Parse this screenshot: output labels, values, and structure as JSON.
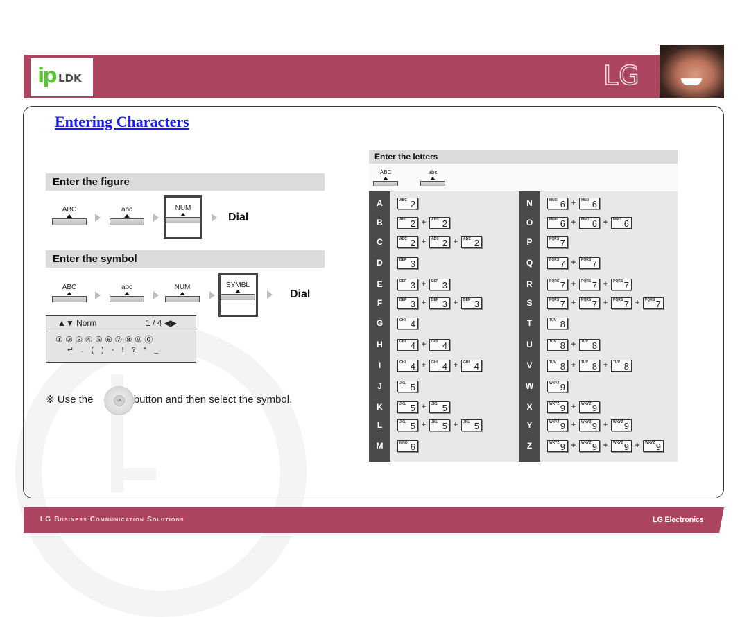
{
  "header": {
    "logo_ip": "ip",
    "logo_ldk": "LDK",
    "brand": "LG"
  },
  "title": "Entering Characters",
  "figure_section": {
    "heading": "Enter the figure",
    "modes": [
      "ABC",
      "abc",
      "NUM"
    ],
    "highlighted": "NUM",
    "result": "Dial"
  },
  "symbol_section": {
    "heading": "Enter the symbol",
    "modes": [
      "ABC",
      "abc",
      "NUM",
      "SYMBL"
    ],
    "highlighted": "SYMBL",
    "result": "Dial",
    "panel": {
      "mode": "▲▼ Norm",
      "page": "1 / 4  ◀▶",
      "row1": "①②③④⑤⑥⑦⑧⑨⓪",
      "row2": "↵ . ( ) - ! ? * _"
    },
    "hint_prefix": "※ Use the",
    "hint_suffix": "button and then select the symbol.",
    "nav_button_label": "OK"
  },
  "letters_section": {
    "heading": "Enter the letters",
    "modes": [
      "ABC",
      "abc"
    ],
    "rows_left": [
      {
        "letter": "A",
        "key_label": "ABC",
        "key": "2",
        "presses": 1
      },
      {
        "letter": "B",
        "key_label": "ABC",
        "key": "2",
        "presses": 2
      },
      {
        "letter": "C",
        "key_label": "ABC",
        "key": "2",
        "presses": 3
      },
      {
        "letter": "D",
        "key_label": "DEF",
        "key": "3",
        "presses": 1
      },
      {
        "letter": "E",
        "key_label": "DEF",
        "key": "3",
        "presses": 2
      },
      {
        "letter": "F",
        "key_label": "DEF",
        "key": "3",
        "presses": 3
      },
      {
        "letter": "G",
        "key_label": "GHI",
        "key": "4",
        "presses": 1
      },
      {
        "letter": "H",
        "key_label": "GHI",
        "key": "4",
        "presses": 2
      },
      {
        "letter": "I",
        "key_label": "GHI",
        "key": "4",
        "presses": 3
      },
      {
        "letter": "J",
        "key_label": "JKL",
        "key": "5",
        "presses": 1
      },
      {
        "letter": "K",
        "key_label": "JKL",
        "key": "5",
        "presses": 2
      },
      {
        "letter": "L",
        "key_label": "JKL",
        "key": "5",
        "presses": 3
      },
      {
        "letter": "M",
        "key_label": "MNO",
        "key": "6",
        "presses": 1
      }
    ],
    "rows_right": [
      {
        "letter": "N",
        "key_label": "MNO",
        "key": "6",
        "presses": 2
      },
      {
        "letter": "O",
        "key_label": "MNO",
        "key": "6",
        "presses": 3
      },
      {
        "letter": "P",
        "key_label": "PQRS",
        "key": "7",
        "presses": 1
      },
      {
        "letter": "Q",
        "key_label": "PQRS",
        "key": "7",
        "presses": 2
      },
      {
        "letter": "R",
        "key_label": "PQRS",
        "key": "7",
        "presses": 3
      },
      {
        "letter": "S",
        "key_label": "PQRS",
        "key": "7",
        "presses": 4
      },
      {
        "letter": "T",
        "key_label": "TUV",
        "key": "8",
        "presses": 1
      },
      {
        "letter": "U",
        "key_label": "TUV",
        "key": "8",
        "presses": 2
      },
      {
        "letter": "V",
        "key_label": "TUV",
        "key": "8",
        "presses": 3
      },
      {
        "letter": "W",
        "key_label": "WXYZ",
        "key": "9",
        "presses": 1
      },
      {
        "letter": "X",
        "key_label": "WXYZ",
        "key": "9",
        "presses": 2
      },
      {
        "letter": "Y",
        "key_label": "WXYZ",
        "key": "9",
        "presses": 3
      },
      {
        "letter": "Z",
        "key_label": "WXYZ",
        "key": "9",
        "presses": 4
      }
    ]
  },
  "footer": {
    "left": "LG Business Communication Solutions",
    "right": "LG Electronics"
  },
  "colors": {
    "brand": "#ab4560",
    "title_link": "#1a1aff",
    "logo_green": "#5cc33a"
  }
}
